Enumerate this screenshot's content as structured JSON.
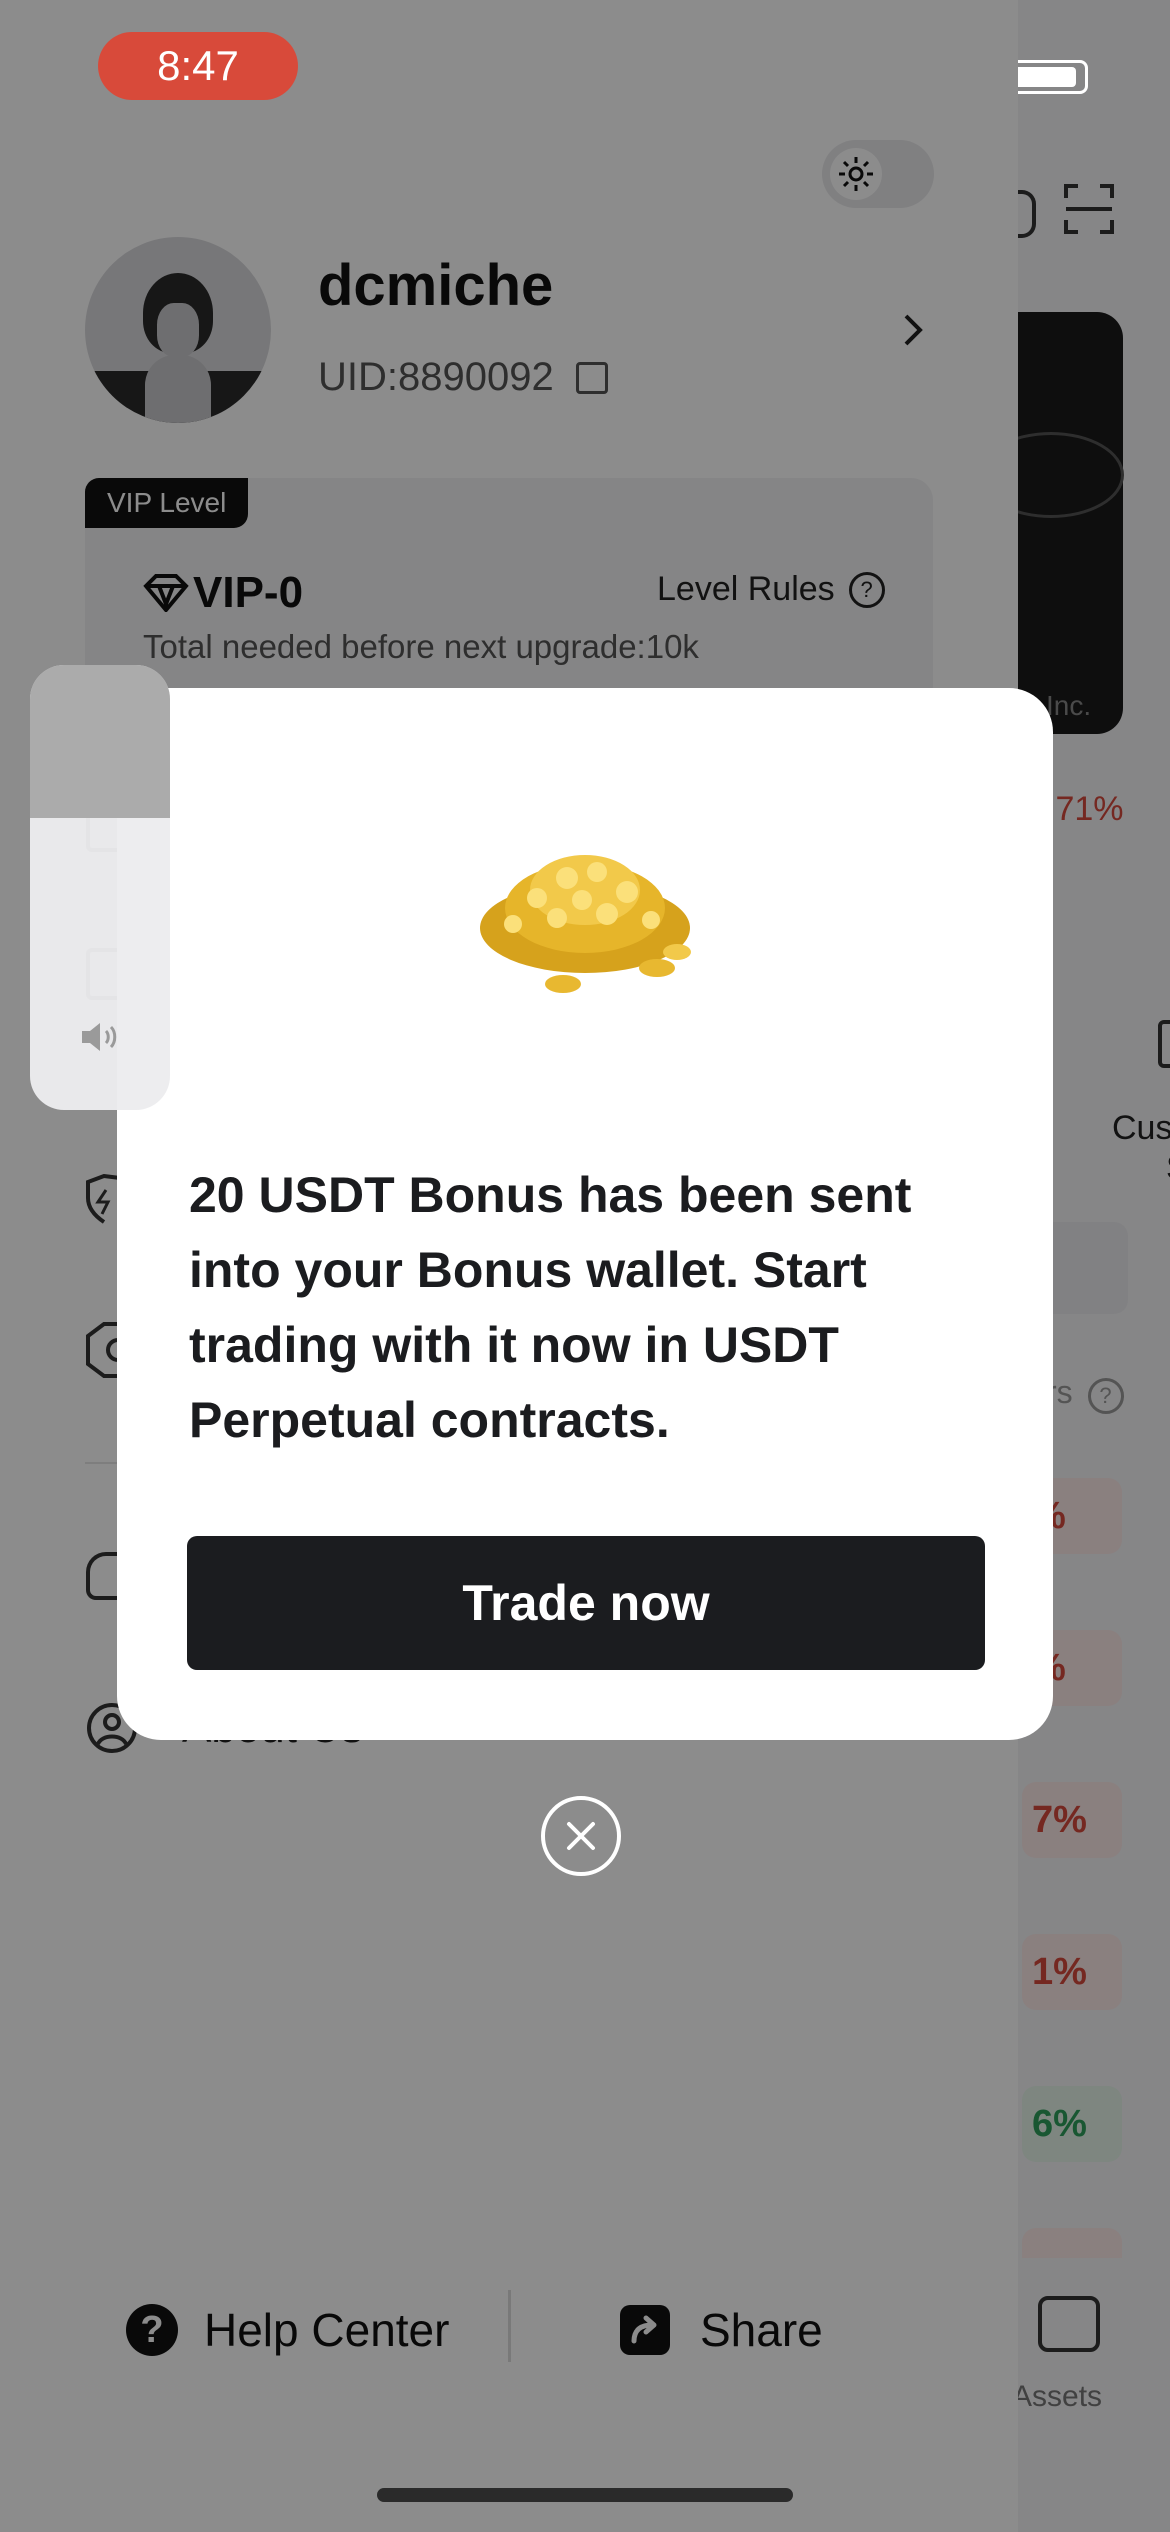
{
  "status_bar": {
    "time": "8:47"
  },
  "background_app": {
    "card_caption": "Inc.",
    "change_top": ".71%",
    "customer_service_label_1": "Cus",
    "customer_service_label_2": "Se",
    "rows_label": "rs",
    "percent_rows": [
      {
        "text": "%",
        "color": "#d64a3c"
      },
      {
        "text": "%",
        "color": "#d64a3c"
      },
      {
        "text": "7%",
        "color": "#d64a3c"
      },
      {
        "text": "1%",
        "color": "#d64a3c"
      },
      {
        "text": "6%",
        "color": "#2f9e5b"
      }
    ],
    "assets_label": "Assets"
  },
  "drawer": {
    "username": "dcmiche",
    "uid": "UID:8890092",
    "vip_badge": "VIP Level",
    "vip_level": "VIP-0",
    "level_rules": "Level Rules",
    "upgrade_text": "Total needed before next upgrade:10k",
    "about_label": "About Us",
    "help_center": "Help Center",
    "share": "Share"
  },
  "modal": {
    "message": "20 USDT Bonus has been sent into your Bonus wallet. Start trading with it now in USDT Perpetual contracts.",
    "trade_button": "Trade now"
  },
  "volume": {
    "level": 0.56
  },
  "colors": {
    "status_time_bg": "#d84a3a",
    "button_bg": "#1b1c1f",
    "red": "#d64a3c",
    "green": "#2f9e5b"
  }
}
